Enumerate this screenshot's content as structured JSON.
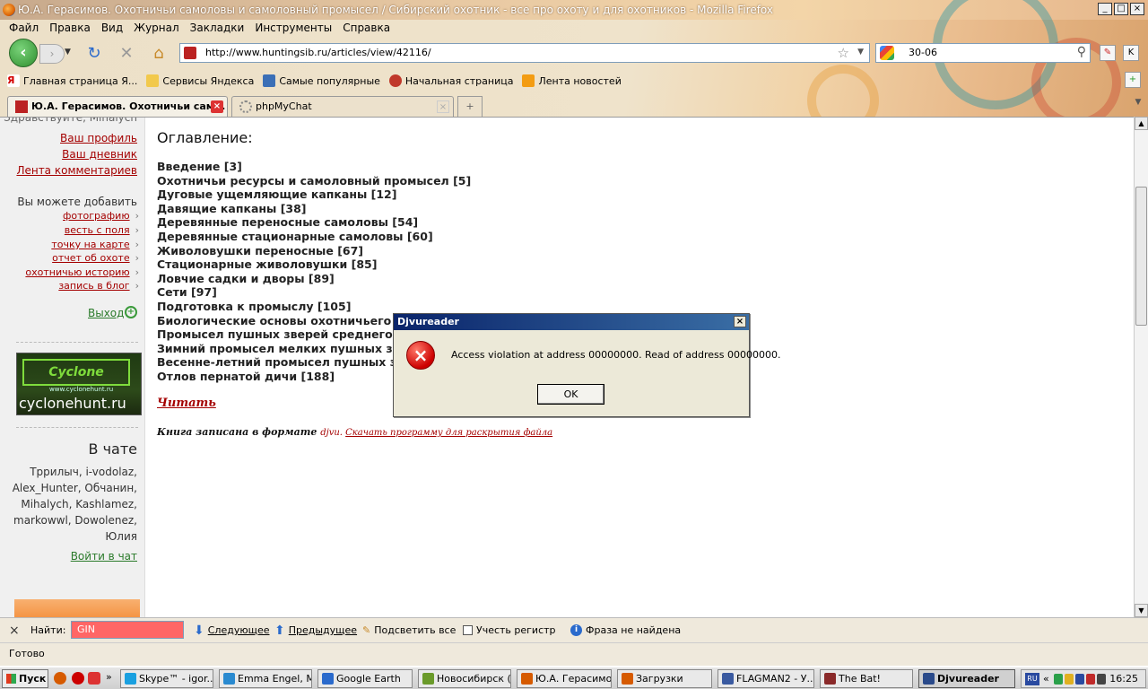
{
  "window": {
    "title": "Ю.А. Герасимов. Охотничьи самоловы и самоловный промысел / Сибирский охотник - все про охоту и для охотников - Mozilla Firefox",
    "controls": [
      "_",
      "□",
      "×"
    ]
  },
  "menu": [
    "Файл",
    "Правка",
    "Вид",
    "Журнал",
    "Закладки",
    "Инструменты",
    "Справка"
  ],
  "nav": {
    "url": "http://www.huntingsib.ru/articles/view/42116/",
    "search_value": "30-06"
  },
  "bookmarks": [
    {
      "label": "Главная страница Я...",
      "icon": "yandex-icon",
      "color": "#d40000"
    },
    {
      "label": "Сервисы Яндекса",
      "icon": "folder-icon",
      "color": "#f2c94c"
    },
    {
      "label": "Самые популярные",
      "icon": "popular-icon",
      "color": "#3b6fb6"
    },
    {
      "label": "Начальная страница",
      "icon": "firefox-icon",
      "color": "#c0392b"
    },
    {
      "label": "Лента новостей",
      "icon": "rss-icon",
      "color": "#f39c12"
    }
  ],
  "tabs": [
    {
      "label": "Ю.А. Герасимов. Охотничьи сам...",
      "active": true
    },
    {
      "label": "phpMyChat",
      "active": false
    }
  ],
  "sidebar": {
    "greeting": "Здравствуйте, Mihalych",
    "profile": "Ваш профиль",
    "diary": "Ваш дневник",
    "comments": "Лента комментариев",
    "add_text": "Вы можете добавить",
    "add_items": [
      "фотографию",
      "весть с поля",
      "точку на карте",
      "отчет об охоте",
      "охотничью историю",
      "запись в блог"
    ],
    "exit": "Выход",
    "banner_logo": "Cyclone",
    "banner_url": "www.cyclonehunt.ru",
    "banner_text": "cyclonehunt.ru",
    "chat_title": "В чате",
    "chat_users": "Тррилыч, i-vodolaz, Alex_Hunter, Обчанин, Mihalych, Kashlamez, markowwl, Dowolenez, Юлия",
    "chat_enter": "Войти в чат"
  },
  "main": {
    "toc_title": "Оглавление:",
    "toc": [
      {
        "title": "Введение",
        "page": "[3]"
      },
      {
        "title": "Охотничьи ресурсы и самоловный промысел",
        "page": "[5]"
      },
      {
        "title": "Дуговые ущемляющие капканы",
        "page": "[12]"
      },
      {
        "title": "Давящие капканы",
        "page": "[38]"
      },
      {
        "title": "Деревянные переносные самоловы",
        "page": "[54]"
      },
      {
        "title": "Деревянные стационарные самоловы",
        "page": "[60]"
      },
      {
        "title": "Живоловушки переносные",
        "page": "[67]"
      },
      {
        "title": "Стационарные живоловушки",
        "page": "[85]"
      },
      {
        "title": "Ловчие садки и дворы",
        "page": "[89]"
      },
      {
        "title": "Сети",
        "page": "[97]"
      },
      {
        "title": "Подготовка к промыслу",
        "page": "[105]"
      },
      {
        "title": "Биологические основы охотничьего пр",
        "page": ""
      },
      {
        "title": "Промысел пушных зверей среднего раз",
        "page": ""
      },
      {
        "title": "Зимний промысел мелких пушных звер",
        "page": ""
      },
      {
        "title": "Весенне-летний промысел пушных звер",
        "page": ""
      },
      {
        "title": "Отлов пернатой дичи",
        "page": "[188]"
      }
    ],
    "read_link": "Читать",
    "format_text": "Книга записана в формате",
    "format_name": "djvu",
    "download_link": "Скачать программу для раскрытия файла"
  },
  "findbar": {
    "label": "Найти:",
    "value": "GIN",
    "next": "Следующее",
    "prev": "Предыдущее",
    "highlight": "Подсветить все",
    "match_case": "Учесть регистр",
    "status": "Фраза не найдена"
  },
  "statusbar": {
    "text": "Готово"
  },
  "taskbar": {
    "start": "Пуск",
    "tasks": [
      {
        "label": "Skype™ - igor....",
        "color": "#1aa0e0",
        "active": false
      },
      {
        "label": "Emma Engel, M...",
        "color": "#2a8ad0",
        "active": false
      },
      {
        "label": "Google Earth",
        "color": "#2a6acc",
        "active": false
      },
      {
        "label": "Новосибирск (...",
        "color": "#6a9a2a",
        "active": false
      },
      {
        "label": "Ю.А. Герасимо...",
        "color": "#d65a00",
        "active": false
      },
      {
        "label": "Загрузки",
        "color": "#d65a00",
        "active": false
      },
      {
        "label": "FLAGMAN2 - У...",
        "color": "#3a5aa0",
        "active": false
      },
      {
        "label": "The Bat!",
        "color": "#8a2a2a",
        "active": false
      },
      {
        "label": "Djvureader",
        "color": "#2a4a8a",
        "active": true
      }
    ],
    "lang": "RU",
    "clock": "16:25"
  },
  "dialog": {
    "title": "Djvureader",
    "message": "Access violation at address 00000000. Read of address 00000000.",
    "ok": "OK"
  }
}
